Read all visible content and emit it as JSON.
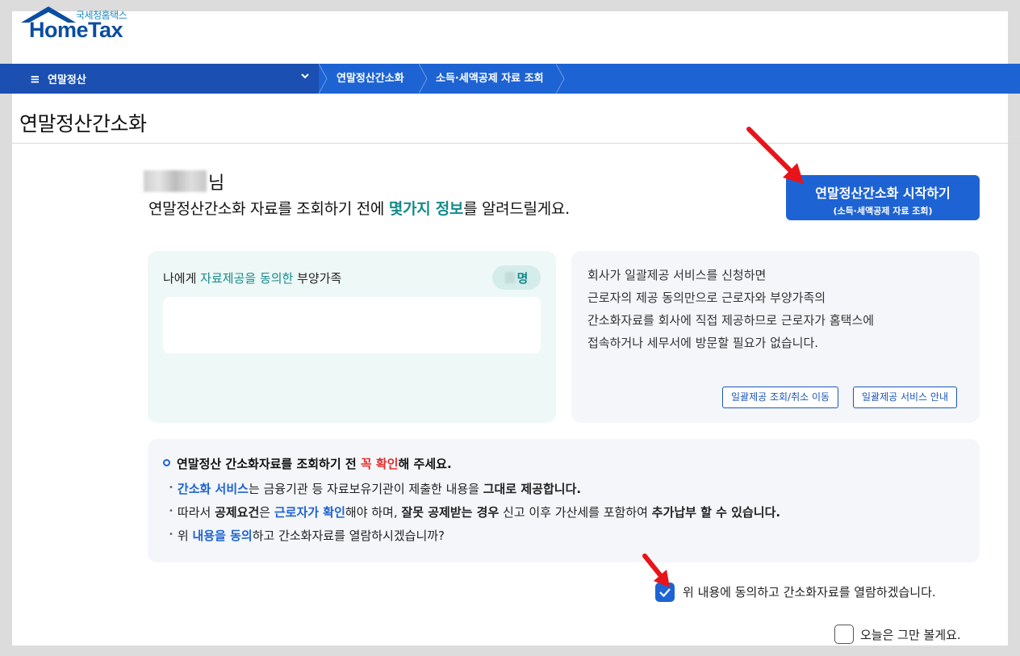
{
  "logo": {
    "korean": "국세청홈택스",
    "english": "HomeTax"
  },
  "nav": {
    "menu_icon": "menu-icon",
    "title": "연말정산",
    "breadcrumbs": [
      "연말정산간소화",
      "소득·세액공제 자료 조회"
    ]
  },
  "page": {
    "title": "연말정산간소화",
    "user_suffix": "님",
    "intro_prefix": "연말정산간소화 자료를 조회하기 전에 ",
    "intro_highlight": "몇가지 정보",
    "intro_suffix": "를 알려드릴게요."
  },
  "start_button": {
    "title": "연말정산간소화 시작하기",
    "subtitle": "(소득·세액공제 자료 조회)"
  },
  "dependents_card": {
    "label_prefix": "나에게 ",
    "label_highlight": "자료제공을 동의한",
    "label_suffix": " 부양가족",
    "count_unit": "명"
  },
  "bulk_card": {
    "lines": [
      "회사가 일괄제공 서비스를 신청하면",
      "근로자의 제공 동의만으로 근로자와 부양가족의",
      "간소화자료를 회사에 직접 제공하므로 근로자가 홈택스에",
      "접속하거나 세무서에 방문할 필요가 없습니다."
    ],
    "buttons": [
      "일괄제공 조회/취소 이동",
      "일괄제공 서비스 안내"
    ]
  },
  "notice": {
    "head_prefix": "연말정산 간소화자료를 조회하기 전 ",
    "head_red": "꼭 확인",
    "head_suffix": "해 주세요.",
    "line1": {
      "blue": "간소화 서비스",
      "mid": "는 금융기관 등 자료보유기관이 제출한 내용을 ",
      "bold": "그대로 제공합니다."
    },
    "line2": {
      "a": "따라서 ",
      "b_bold": "공제요건",
      "c": "은 ",
      "d_blue": "근로자가 확인",
      "e": "해야 하며, ",
      "f_bold": "잘못 공제받는 경우",
      "g": " 신고 이후 가산세를 포함하여 ",
      "h_bold": "추가납부 할 수 있습니다."
    },
    "line3": {
      "a": "위 ",
      "b_blue": "내용을 동의",
      "c": "하고 간소화자료를 열람하시겠습니까?"
    }
  },
  "agree": {
    "label": "위 내용에 동의하고 간소화자료를 열람하겠습니다.",
    "checked": true
  },
  "skip_today": {
    "label": "오늘은 그만 볼게요.",
    "checked": false
  },
  "colors": {
    "primary": "#1e63d3",
    "teal": "#158a8a",
    "annotation_red": "#e8141a"
  }
}
